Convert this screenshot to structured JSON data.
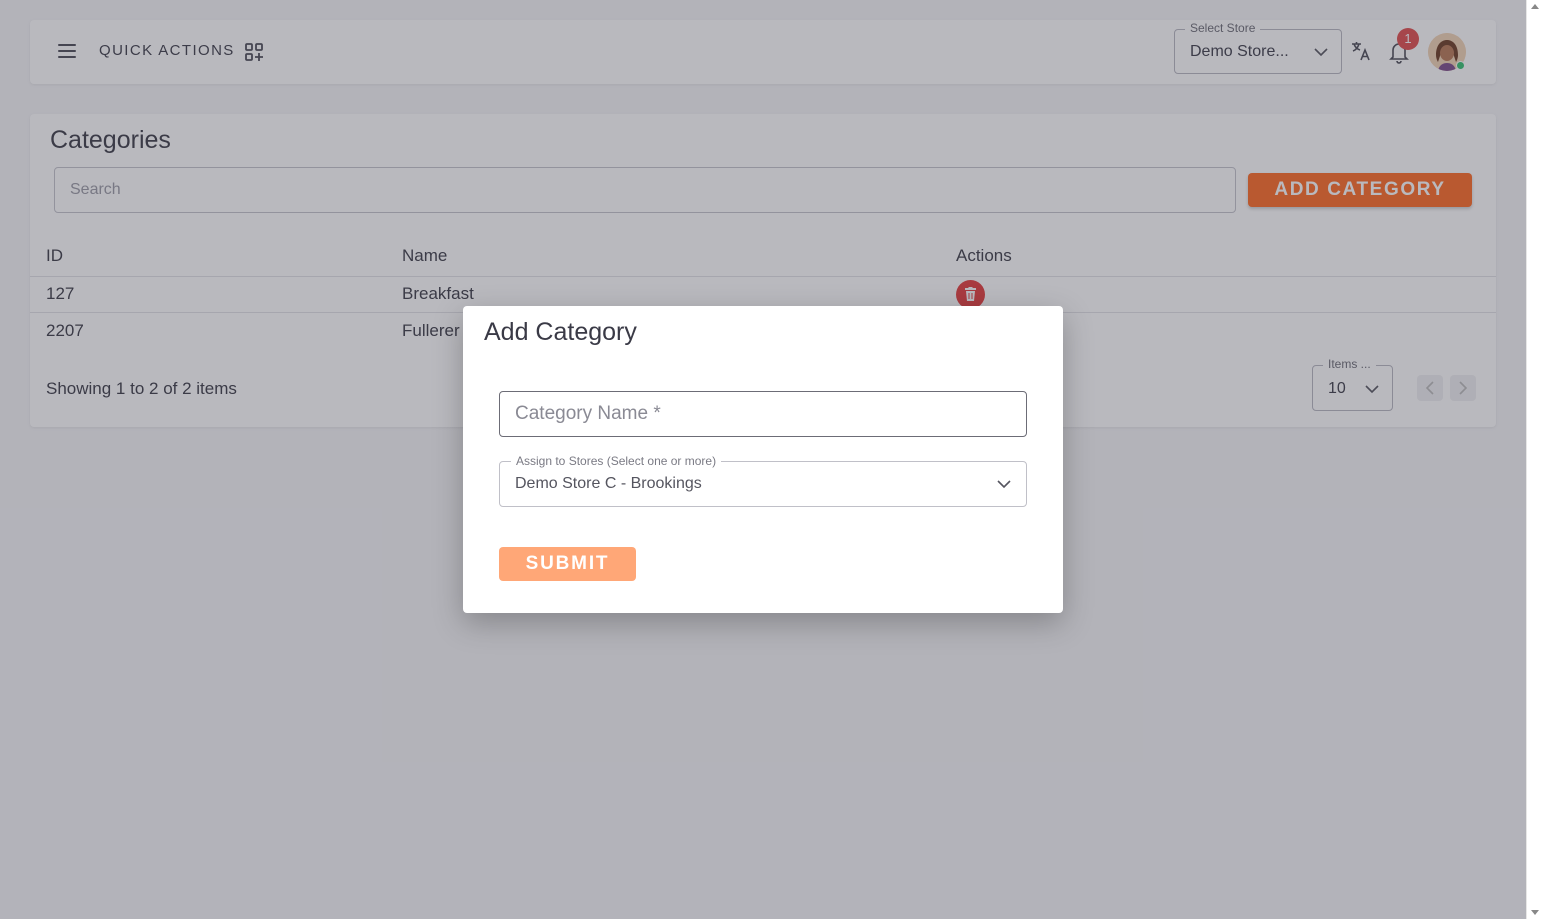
{
  "header": {
    "quick_actions_label": "QUICK ACTIONS",
    "store_select": {
      "legend": "Select Store",
      "value": "Demo Store..."
    },
    "notification_count": "1"
  },
  "categories": {
    "title": "Categories",
    "search_placeholder": "Search",
    "add_button_label": "ADD CATEGORY",
    "columns": [
      "ID",
      "Name",
      "Actions"
    ],
    "rows": [
      {
        "id": "127",
        "name": "Breakfast"
      },
      {
        "id": "2207",
        "name": "Fullerer"
      }
    ],
    "showing_text": "Showing 1 to 2 of 2 items",
    "items_per_page": {
      "legend": "Items ...",
      "value": "10"
    }
  },
  "modal": {
    "title": "Add Category",
    "category_name_placeholder": "Category Name *",
    "stores_legend": "Assign to Stores (Select one or more)",
    "stores_value": "Demo Store C - Brookings",
    "submit_label": "SUBMIT"
  },
  "colors": {
    "accent": "#ff6a21",
    "submit_disabled": "#ffa777",
    "danger": "#e53b3b",
    "online": "#35c06f"
  },
  "icons": [
    "menu-icon",
    "grid-plus-icon",
    "chevron-down-icon",
    "translate-icon",
    "bell-icon",
    "trash-icon",
    "chevron-left-icon",
    "chevron-right-icon"
  ]
}
